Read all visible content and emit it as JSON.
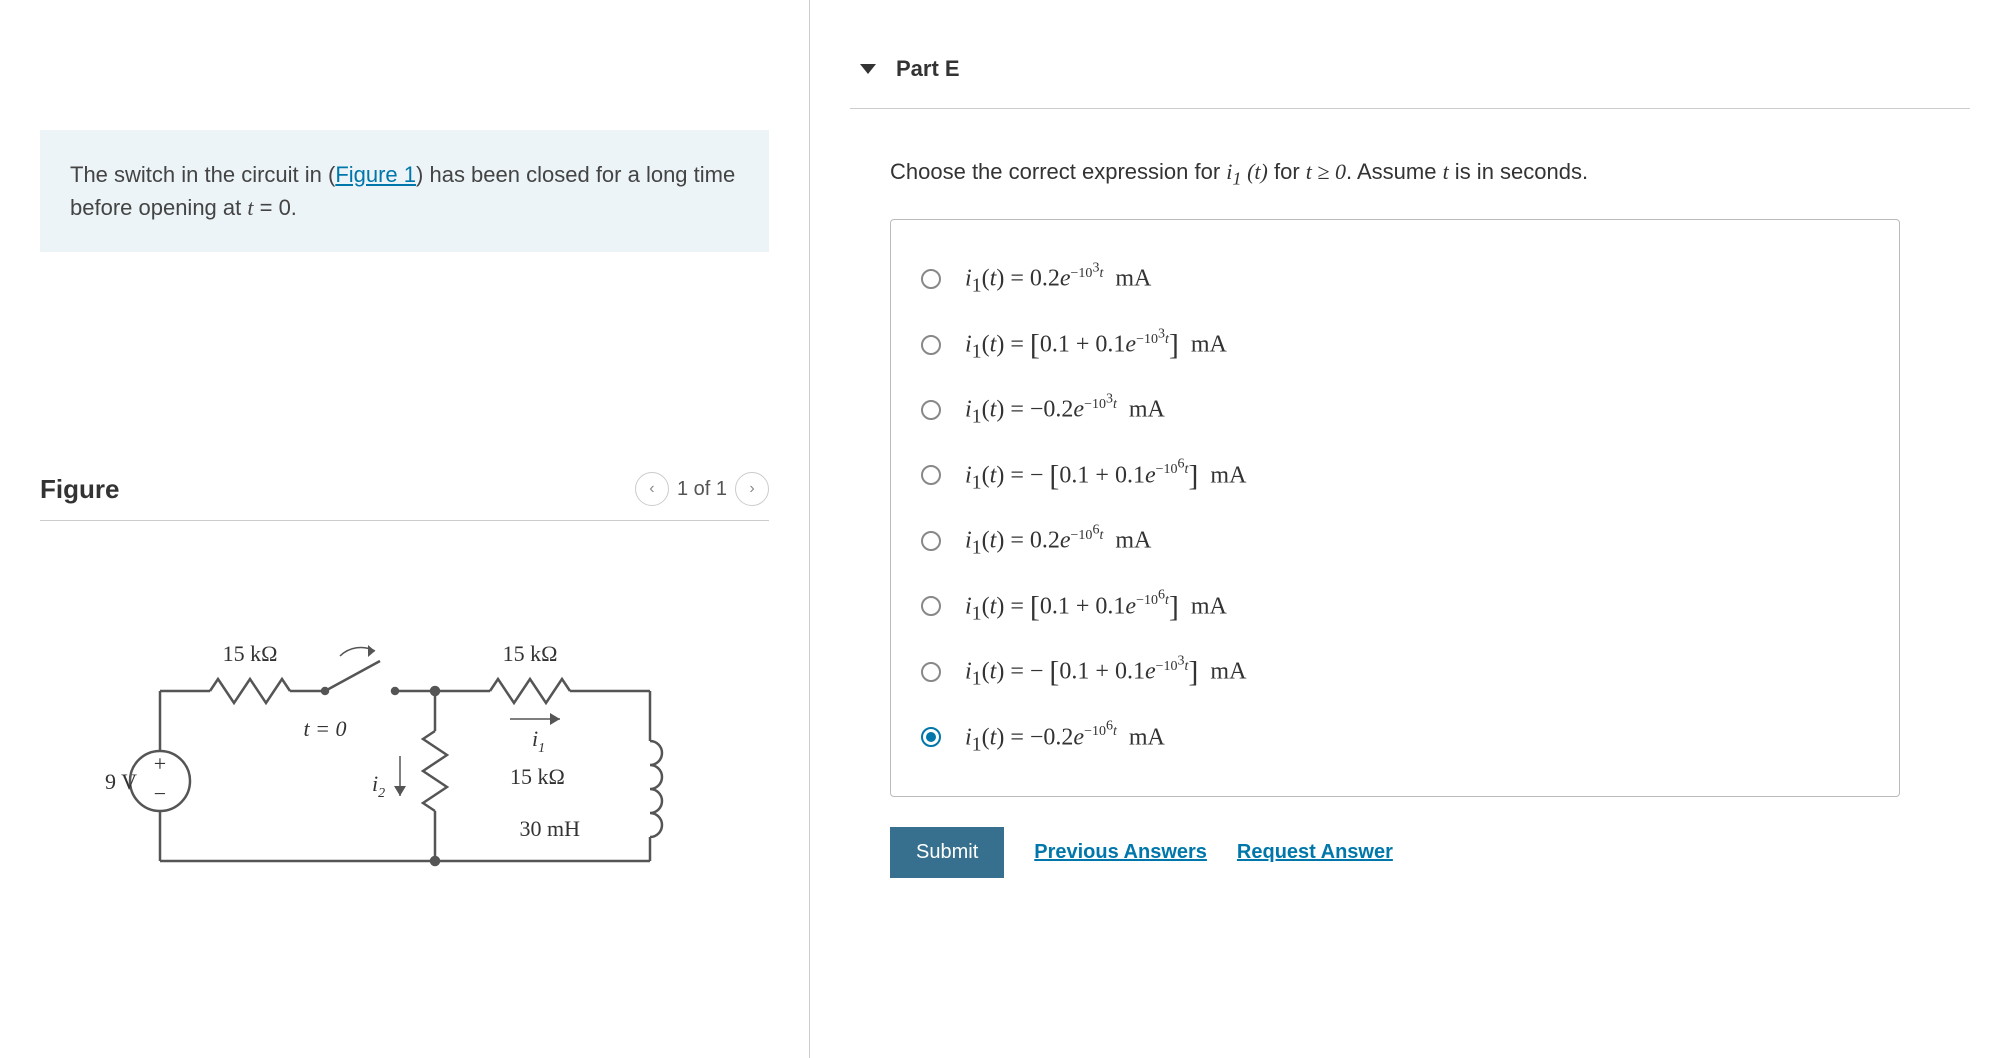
{
  "problem": {
    "text_before_link": "The switch in the circuit in (",
    "link_text": "Figure 1",
    "text_after_link": ") has been closed for a long time before opening at ",
    "var": "t",
    "equals_zero": " = 0."
  },
  "figure": {
    "title": "Figure",
    "pager": "1 of 1"
  },
  "circuit": {
    "r1": "15 kΩ",
    "r2": "15 kΩ",
    "r3": "15 kΩ",
    "vs": "9 V",
    "L": "30 mH",
    "i1_label": "i",
    "i1_sub": "1",
    "i2_label": "i",
    "i2_sub": "2",
    "t0_label": "t = 0"
  },
  "part": {
    "label": "Part E",
    "question_prefix": "Choose the correct expression for ",
    "question_var": "i₁ (t)",
    "question_mid": " for ",
    "question_cond": "t ≥ 0",
    "question_suffix": ". Assume ",
    "question_tvar": "t",
    "question_end": " is in seconds."
  },
  "options": [
    {
      "selected": false,
      "expr": "i₁(t) = 0.2e^{-10^3 t} mA"
    },
    {
      "selected": false,
      "expr": "i₁(t) = [0.1 + 0.1e^{-10^3 t}] mA"
    },
    {
      "selected": false,
      "expr": "i₁(t) = −0.2e^{-10^3 t} mA"
    },
    {
      "selected": false,
      "expr": "i₁(t) = −[0.1 + 0.1e^{-10^6 t}] mA"
    },
    {
      "selected": false,
      "expr": "i₁(t) = 0.2e^{-10^6 t} mA"
    },
    {
      "selected": false,
      "expr": "i₁(t) = [0.1 + 0.1e^{-10^6 t}] mA"
    },
    {
      "selected": false,
      "expr": "i₁(t) = −[0.1 + 0.1e^{-10^3 t}] mA"
    },
    {
      "selected": true,
      "expr": "i₁(t) = −0.2e^{-10^6 t} mA"
    }
  ],
  "actions": {
    "submit": "Submit",
    "prev": "Previous Answers",
    "req": "Request Answer"
  }
}
